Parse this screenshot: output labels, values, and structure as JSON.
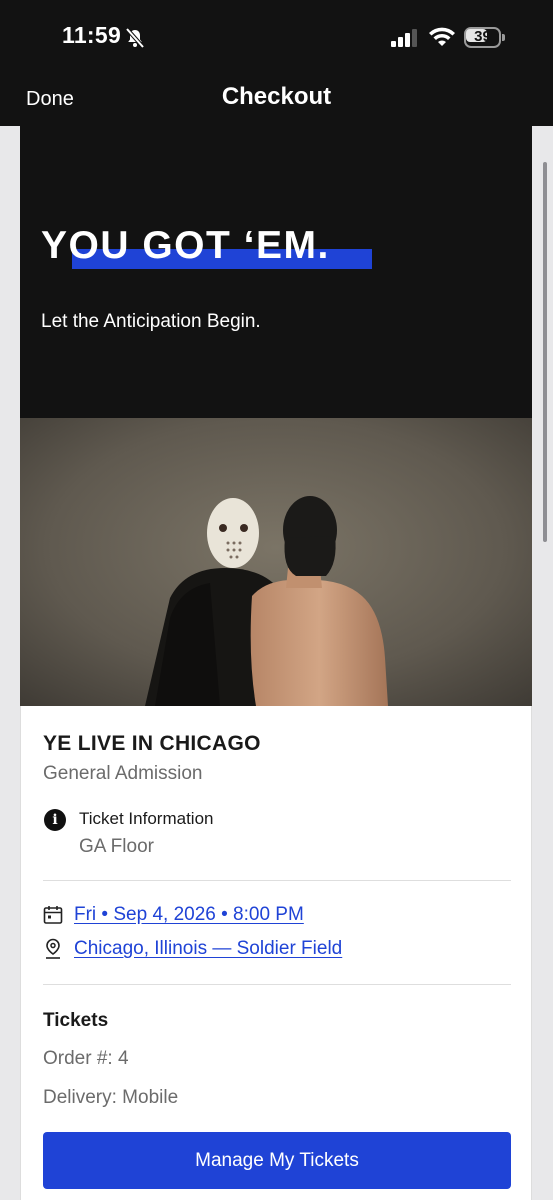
{
  "status_bar": {
    "time": "11:59",
    "battery": "39",
    "icons": [
      "bell-muted-icon",
      "cellular-signal-icon",
      "wifi-icon",
      "battery-icon"
    ]
  },
  "nav": {
    "done_label": "Done",
    "title": "Checkout"
  },
  "hero": {
    "headline": "YOU GOT ‘EM.",
    "subtext": "Let the Anticipation Begin.",
    "accent_color": "#1f43d6"
  },
  "event": {
    "title": "YE LIVE IN CHICAGO",
    "subtitle": "General Admission",
    "ticket_info_label": "Ticket Information",
    "ticket_info_value": "GA Floor",
    "datetime": "Fri • Sep 4, 2026 • 8:00 PM",
    "location": "Chicago, Illinois — Soldier Field"
  },
  "tickets": {
    "heading": "Tickets",
    "order_label": "Order #: 4",
    "delivery": "Delivery: Mobile",
    "manage_button": "Manage My Tickets"
  },
  "colors": {
    "header_bg": "#121212",
    "link": "#1f43d6",
    "button": "#1f43d6"
  }
}
